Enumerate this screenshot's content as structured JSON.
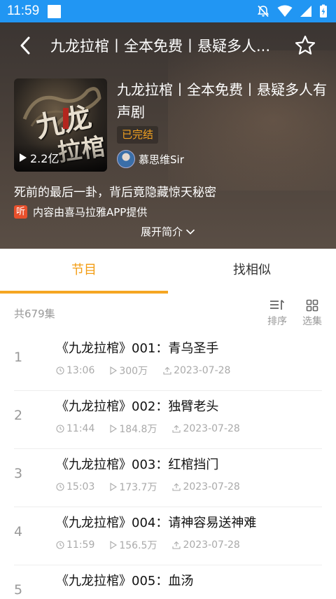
{
  "status_bar": {
    "time": "11:59"
  },
  "header": {
    "nav_title": "九龙拉棺丨全本免费丨悬疑多人...",
    "cover": {
      "text_line1": "九龙",
      "text_line2": "拉棺",
      "play_count": "2.2亿"
    },
    "album_title": "九龙拉棺丨全本免费丨悬疑多人有声剧",
    "status_badge": "已完结",
    "author_name": "慕思维Sir",
    "description": "死前的最后一卦，背后竟隐藏惊天秘密",
    "provider_icon": "听",
    "provider_text": "内容由喜马拉雅APP提供",
    "expand_label": "展开简介"
  },
  "tabs": [
    {
      "label": "节目",
      "active": true
    },
    {
      "label": "找相似",
      "active": false
    }
  ],
  "list_header": {
    "count": "共679集",
    "sort_label": "排序",
    "select_label": "选集"
  },
  "episodes": [
    {
      "num": "1",
      "title": "《九龙拉棺》001：青乌圣手",
      "duration": "13:06",
      "plays": "300万",
      "date": "2023-07-28"
    },
    {
      "num": "2",
      "title": "《九龙拉棺》002：独臂老头",
      "duration": "11:44",
      "plays": "184.8万",
      "date": "2023-07-28"
    },
    {
      "num": "3",
      "title": "《九龙拉棺》003：红棺挡门",
      "duration": "15:03",
      "plays": "173.7万",
      "date": "2023-07-28"
    },
    {
      "num": "4",
      "title": "《九龙拉棺》004：请神容易送神难",
      "duration": "11:59",
      "plays": "156.5万",
      "date": "2023-07-28"
    },
    {
      "num": "5",
      "title": "《九龙拉棺》005：血汤",
      "duration": "",
      "plays": "",
      "date": ""
    }
  ],
  "colors": {
    "status_bar": "#2196f3",
    "accent": "#f39c12",
    "badge_text": "#f0a020"
  }
}
